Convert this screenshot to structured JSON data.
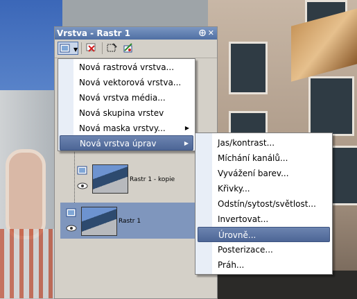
{
  "panel": {
    "title": "Vrstva - Rastr 1",
    "pin_glyph": "⨁",
    "close_glyph": "✕"
  },
  "toolbar": {
    "buttons": [
      "new-layer-dropdown",
      "delete-layer",
      "select-layer",
      "layer-properties"
    ]
  },
  "layers": [
    {
      "name": "Rastr 1 - kopie",
      "selected": false
    },
    {
      "name": "Rastr 1",
      "selected": true
    }
  ],
  "new_layer_menu": {
    "items": [
      {
        "label": "Nová rastrová vrstva...",
        "submenu": false
      },
      {
        "label": "Nová vektorová vrstva...",
        "submenu": false
      },
      {
        "label": "Nová vrstva média...",
        "submenu": false
      },
      {
        "label": "Nová skupina vrstev",
        "submenu": false
      },
      {
        "label": "Nová maska vrstvy...",
        "submenu": true
      },
      {
        "label": "Nová vrstva úprav",
        "submenu": true,
        "highlighted": true
      }
    ]
  },
  "adjust_menu": {
    "items": [
      {
        "label": "Jas/kontrast..."
      },
      {
        "label": "Míchání kanálů..."
      },
      {
        "label": "Vyvážení barev..."
      },
      {
        "label": "Křivky..."
      },
      {
        "label": "Odstín/sytost/světlost..."
      },
      {
        "label": "Invertovat..."
      },
      {
        "label": "Úrovně...",
        "highlighted": true
      },
      {
        "label": "Posterizace..."
      },
      {
        "label": "Práh..."
      }
    ]
  },
  "colors": {
    "title_bar": "#4f6fa3",
    "selection": "#7f96bd",
    "menu_highlight": "#5670a0"
  }
}
